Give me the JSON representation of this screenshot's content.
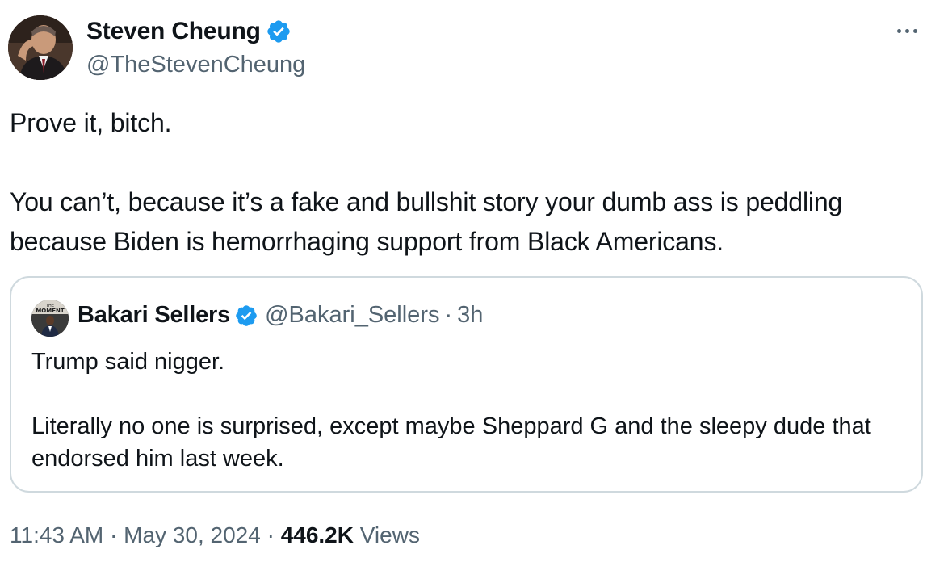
{
  "author": {
    "display_name": "Steven Cheung",
    "handle": "@TheStevenCheung",
    "verified": true,
    "avatar_icon": "author-photo"
  },
  "tweet": {
    "paragraphs": [
      "Prove it, bitch.",
      "You can’t, because it’s a fake and bullshit story your dumb ass is peddling because Biden is hemorrhaging support from Black Americans."
    ]
  },
  "quoted_tweet": {
    "display_name": "Bakari Sellers",
    "handle": "@Bakari_Sellers",
    "separator": "·",
    "time": "3h",
    "verified": true,
    "avatar_label": "THE MOMENT",
    "paragraphs": [
      "Trump said nigger.",
      "Literally no one is surprised, except maybe Sheppard G and the sleepy dude that endorsed him last week."
    ]
  },
  "meta": {
    "time": "11:43 AM",
    "separator": "·",
    "date": "May 30, 2024",
    "views_count": "446.2K",
    "views_label": "Views"
  },
  "colors": {
    "verified": "#1d9bf0",
    "secondary_text": "#536471",
    "border": "#cfd9de"
  },
  "icons": {
    "more": "more-dots-icon",
    "verified": "verified-badge-icon"
  }
}
